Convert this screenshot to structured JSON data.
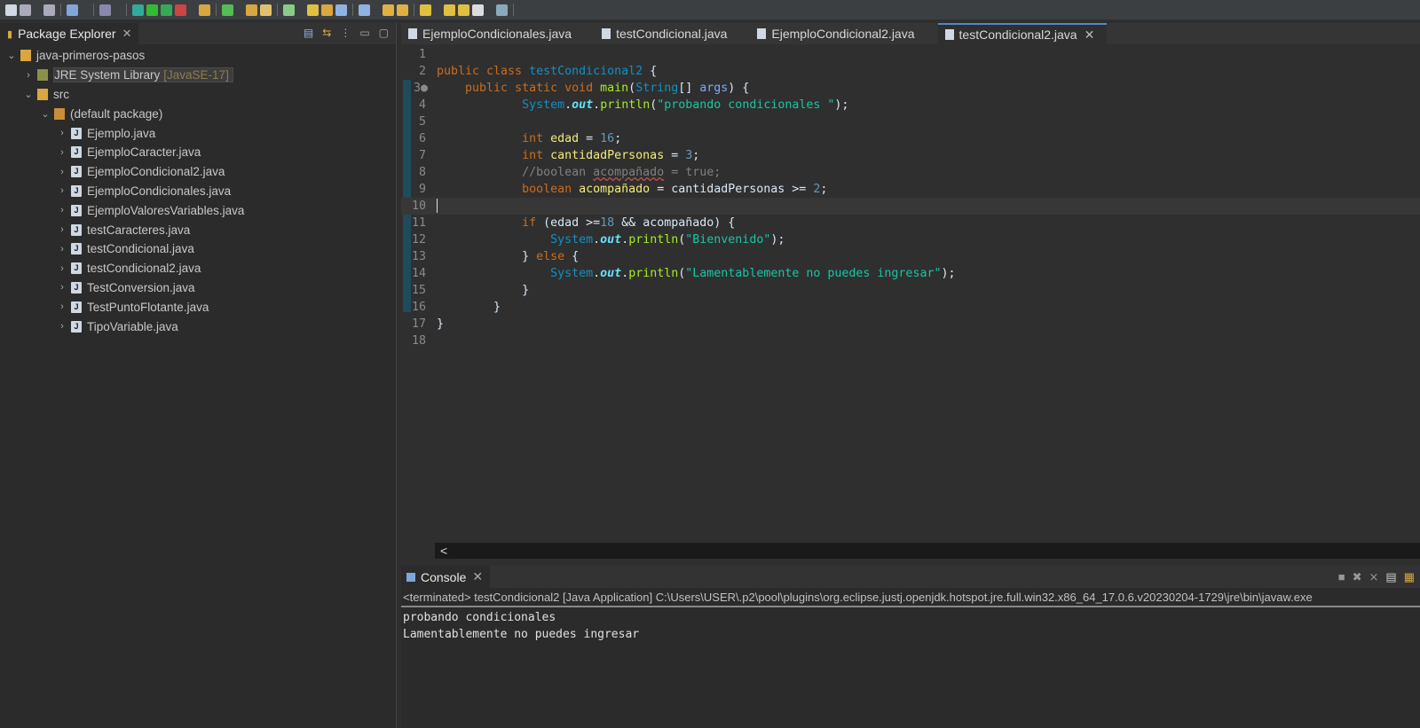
{
  "toolbar": {
    "icons": [
      "new-icon",
      "save-icon",
      "save-all-icon",
      "console-icon",
      "search-icon",
      "debug-icon",
      "run-icon",
      "run-external-icon",
      "coverage-icon",
      "new-package-icon",
      "new-class-icon",
      "open-folder-icon",
      "edit-icon",
      "task-icon",
      "highlight-icon",
      "annotation-icon",
      "show-whitespace-icon",
      "paragraph-icon",
      "next-annotation-icon",
      "prev-annotation-icon",
      "back-icon",
      "forward-icon",
      "nav-back-icon",
      "nav-forward-icon",
      "open-perspective-icon"
    ]
  },
  "package_explorer": {
    "title": "Package Explorer",
    "tree": [
      {
        "label": "java-primeros-pasos",
        "level": 0,
        "expanded": true,
        "icon": "project-icon"
      },
      {
        "label": "JRE System Library",
        "suffix": "[JavaSE-17]",
        "level": 1,
        "expanded": false,
        "icon": "library-icon",
        "selected": true
      },
      {
        "label": "src",
        "level": 1,
        "expanded": true,
        "icon": "source-folder-icon"
      },
      {
        "label": "(default package)",
        "level": 2,
        "expanded": true,
        "icon": "package-icon"
      },
      {
        "label": "Ejemplo.java",
        "level": 3,
        "icon": "java-file-icon"
      },
      {
        "label": "EjemploCaracter.java",
        "level": 3,
        "icon": "java-file-icon"
      },
      {
        "label": "EjemploCondicional2.java",
        "level": 3,
        "icon": "java-file-icon"
      },
      {
        "label": "EjemploCondicionales.java",
        "level": 3,
        "icon": "java-file-icon"
      },
      {
        "label": "EjemploValoresVariables.java",
        "level": 3,
        "icon": "java-file-icon"
      },
      {
        "label": "testCaracteres.java",
        "level": 3,
        "icon": "java-file-icon"
      },
      {
        "label": "testCondicional.java",
        "level": 3,
        "icon": "java-file-icon"
      },
      {
        "label": "testCondicional2.java",
        "level": 3,
        "icon": "java-file-icon"
      },
      {
        "label": "TestConversion.java",
        "level": 3,
        "icon": "java-file-icon"
      },
      {
        "label": "TestPuntoFlotante.java",
        "level": 3,
        "icon": "java-file-icon"
      },
      {
        "label": "TipoVariable.java",
        "level": 3,
        "icon": "java-file-icon"
      }
    ]
  },
  "editor": {
    "tabs": [
      {
        "label": "EjemploCondicionales.java"
      },
      {
        "label": "testCondicional.java"
      },
      {
        "label": "EjemploCondicional2.java"
      },
      {
        "label": "testCondicional2.java",
        "active": true
      }
    ],
    "current_line": 10,
    "lines": [
      [],
      [
        [
          "public class ",
          "kw"
        ],
        [
          "testCondicional2",
          "cls"
        ],
        [
          " {",
          ""
        ]
      ],
      [
        [
          "    ",
          ""
        ],
        [
          "public static void ",
          "kw"
        ],
        [
          "main",
          "mth"
        ],
        [
          "(",
          ""
        ],
        [
          "String",
          "cls"
        ],
        [
          "[] ",
          ""
        ],
        [
          "args",
          "prm"
        ],
        [
          ") {",
          ""
        ]
      ],
      [
        [
          "            ",
          ""
        ],
        [
          "System",
          "cls"
        ],
        [
          ".",
          ""
        ],
        [
          "out",
          "fld"
        ],
        [
          ".",
          ""
        ],
        [
          "println",
          "mth"
        ],
        [
          "(",
          ""
        ],
        [
          "\"probando condicionales \"",
          "str"
        ],
        [
          ");",
          ""
        ]
      ],
      [],
      [
        [
          "            ",
          ""
        ],
        [
          "int ",
          "kw"
        ],
        [
          "edad",
          "var"
        ],
        [
          " = ",
          ""
        ],
        [
          "16",
          "num"
        ],
        [
          ";",
          ""
        ]
      ],
      [
        [
          "            ",
          ""
        ],
        [
          "int ",
          "kw"
        ],
        [
          "cantidadPersonas",
          "var"
        ],
        [
          " = ",
          ""
        ],
        [
          "3",
          "num"
        ],
        [
          ";",
          ""
        ]
      ],
      [
        [
          "            ",
          ""
        ],
        [
          "//boolean ",
          "cmt"
        ],
        [
          "acompañado",
          "cmt sq"
        ],
        [
          " = true;",
          "cmt"
        ]
      ],
      [
        [
          "            ",
          ""
        ],
        [
          "boolean ",
          "kw"
        ],
        [
          "acompañado",
          "var"
        ],
        [
          " = cantidadPersonas >= ",
          ""
        ],
        [
          "2",
          "num"
        ],
        [
          ";",
          ""
        ]
      ],
      [],
      [
        [
          "            ",
          ""
        ],
        [
          "if ",
          "kw"
        ],
        [
          "(edad >=",
          ""
        ],
        [
          "18",
          "num"
        ],
        [
          " && acompañado) {",
          ""
        ]
      ],
      [
        [
          "                ",
          ""
        ],
        [
          "System",
          "cls"
        ],
        [
          ".",
          ""
        ],
        [
          "out",
          "fld"
        ],
        [
          ".",
          ""
        ],
        [
          "println",
          "mth"
        ],
        [
          "(",
          ""
        ],
        [
          "\"Bienvenido\"",
          "str"
        ],
        [
          ");",
          ""
        ]
      ],
      [
        [
          "            } ",
          ""
        ],
        [
          "else ",
          "kw"
        ],
        [
          "{",
          ""
        ]
      ],
      [
        [
          "                ",
          ""
        ],
        [
          "System",
          "cls"
        ],
        [
          ".",
          ""
        ],
        [
          "out",
          "fld"
        ],
        [
          ".",
          ""
        ],
        [
          "println",
          "mth"
        ],
        [
          "(",
          ""
        ],
        [
          "\"Lamentablemente no puedes ingresar\"",
          "str"
        ],
        [
          ");",
          ""
        ]
      ],
      [
        [
          "            }",
          ""
        ]
      ],
      [
        [
          "        }",
          ""
        ]
      ],
      [
        [
          "}",
          ""
        ]
      ],
      []
    ],
    "scroll_left_label": "<"
  },
  "console": {
    "title": "Console",
    "status": "<terminated> testCondicional2 [Java Application] C:\\Users\\USER\\.p2\\pool\\plugins\\org.eclipse.justj.openjdk.hotspot.jre.full.win32.x86_64_17.0.6.v20230204-1729\\jre\\bin\\javaw.exe",
    "output": [
      "probando condicionales",
      "Lamentablemente no puedes ingresar"
    ]
  },
  "colors": {
    "keyword": "#cc6c1d",
    "class": "#1290c3",
    "method": "#a7ec21",
    "string": "#17c6a3",
    "variable": "#f3ec79",
    "field": "#66e1f8",
    "comment": "#808080",
    "number": "#6897bb",
    "active_tab": "#4a8ad0"
  }
}
